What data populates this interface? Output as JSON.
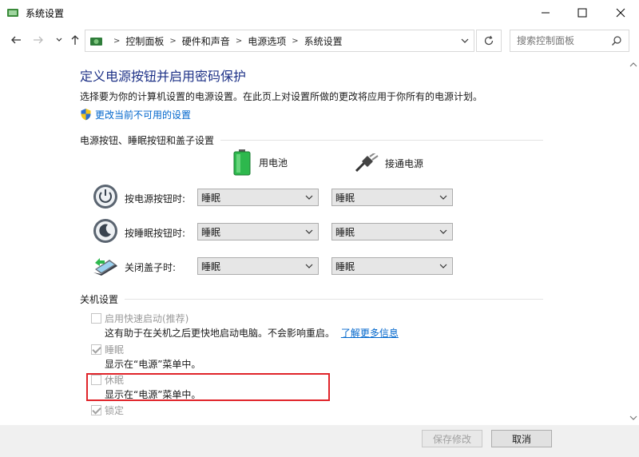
{
  "window": {
    "title": "系统设置"
  },
  "address": {
    "crumbs": [
      "控制面板",
      "硬件和声音",
      "电源选项",
      "系统设置"
    ],
    "search_placeholder": "搜索控制面板"
  },
  "content": {
    "heading": "定义电源按钮并启用密码保护",
    "description": "选择要为你的计算机设置的电源设置。在此页上对设置所做的更改将应用于你所有的电源计划。",
    "change_link": "更改当前不可用的设置"
  },
  "power_buttons": {
    "group_label": "电源按钮、睡眠按钮和盖子设置",
    "col_battery": "用电池",
    "col_plugged": "接通电源",
    "rows": [
      {
        "label": "按电源按钮时:",
        "battery": "睡眠",
        "plugged": "睡眠"
      },
      {
        "label": "按睡眠按钮时:",
        "battery": "睡眠",
        "plugged": "睡眠"
      },
      {
        "label": "关闭盖子时:",
        "battery": "睡眠",
        "plugged": "睡眠"
      }
    ]
  },
  "shutdown": {
    "group_label": "关机设置",
    "options": [
      {
        "label": "启用快速启动(推荐)",
        "checked": false,
        "desc": "这有助于在关机之后更快地启动电脑。不会影响重启。",
        "link": "了解更多信息"
      },
      {
        "label": "睡眠",
        "checked": true,
        "desc": "显示在“电源”菜单中。"
      },
      {
        "label": "休眠",
        "checked": false,
        "desc": "显示在“电源”菜单中。"
      },
      {
        "label": "锁定",
        "checked": true
      }
    ]
  },
  "footer": {
    "save": "保存修改",
    "cancel": "取消"
  },
  "colors": {
    "heading": "#1e3287",
    "link": "#0066cc",
    "highlight": "#e0242a"
  }
}
